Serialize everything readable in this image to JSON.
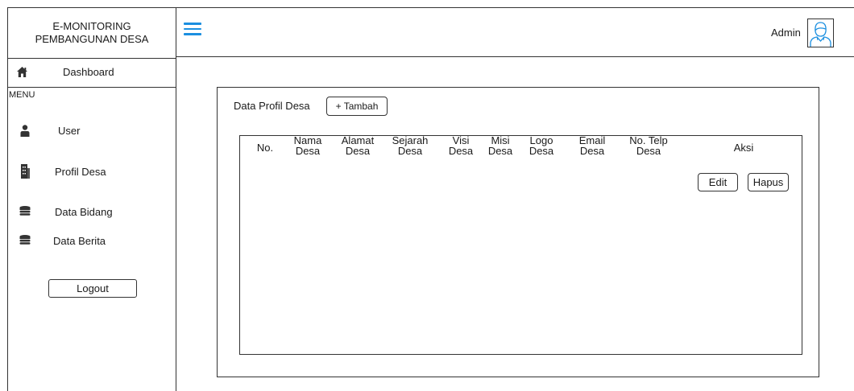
{
  "brand": {
    "line1": "E-MONITORING",
    "line2": "PEMBANGUNAN DESA"
  },
  "sidebar": {
    "dashboard_label": "Dashboard",
    "menu_label": "MENU",
    "items": [
      {
        "label": "User",
        "icon": "user-icon"
      },
      {
        "label": "Profil Desa",
        "icon": "building-icon"
      },
      {
        "label": "Data Bidang",
        "icon": "database-icon"
      },
      {
        "label": "Data Berita",
        "icon": "database-icon"
      }
    ],
    "logout_label": "Logout"
  },
  "header": {
    "user_label": "Admin",
    "menu_icon": "hamburger-icon",
    "avatar_icon": "avatar-icon",
    "accent_color": "#1b8fe0"
  },
  "main": {
    "title": "Data Profil Desa",
    "add_button": "+ Tambah",
    "table": {
      "columns": [
        {
          "line1": "No.",
          "line2": ""
        },
        {
          "line1": "Nama",
          "line2": "Desa"
        },
        {
          "line1": "Alamat",
          "line2": "Desa"
        },
        {
          "line1": "Sejarah",
          "line2": "Desa"
        },
        {
          "line1": "Visi",
          "line2": "Desa"
        },
        {
          "line1": "Misi",
          "line2": "Desa"
        },
        {
          "line1": "Logo",
          "line2": "Desa"
        },
        {
          "line1": "Email",
          "line2": "Desa"
        },
        {
          "line1": "No. Telp",
          "line2": "Desa"
        },
        {
          "line1": "Aksi",
          "line2": ""
        }
      ],
      "actions": {
        "edit": "Edit",
        "delete": "Hapus"
      }
    }
  }
}
